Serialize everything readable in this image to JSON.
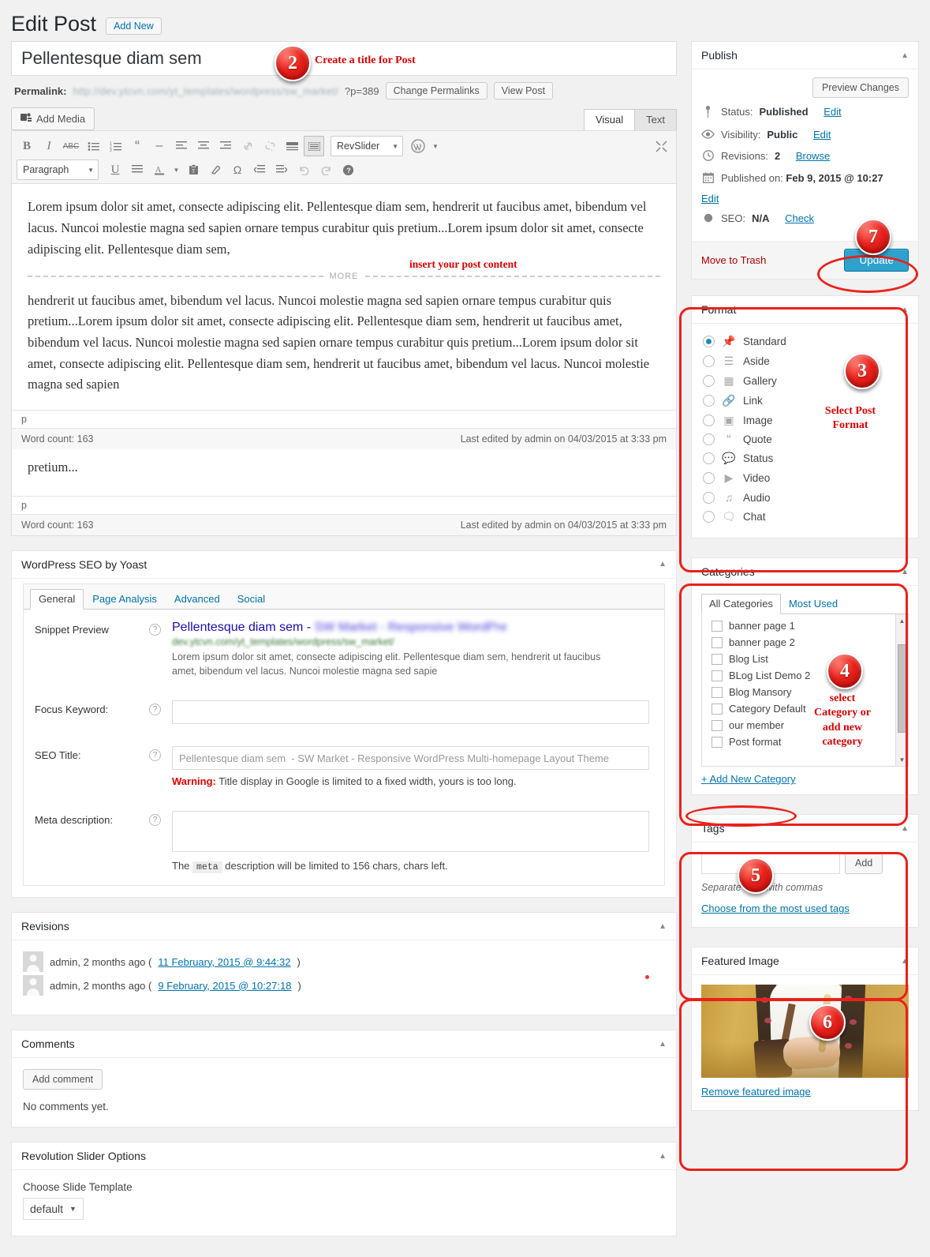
{
  "header": {
    "title": "Edit Post",
    "add_new": "Add New"
  },
  "title_field": {
    "value": "Pellentesque diam sem"
  },
  "permalink": {
    "label": "Permalink:",
    "url": "http://dev.ytcvn.com/yt_templates/wordpress/sw_market/",
    "url_tail": "?p=389",
    "change_button": "Change Permalinks",
    "view_button": "View Post"
  },
  "editor": {
    "add_media": "Add Media",
    "tab_visual": "Visual",
    "tab_text": "Text",
    "toolbar": {
      "revslider": "RevSlider",
      "paragraph": "Paragraph"
    },
    "paragraph1": "Lorem ipsum dolor sit amet, consecte adipiscing elit. Pellentesque diam sem, hendrerit ut faucibus amet, bibendum vel lacus. Nuncoi molestie magna sed sapien ornare tempus curabitur quis pretium...Lorem ipsum dolor sit amet, consecte adipiscing elit. Pellentesque diam sem,",
    "more_label": "MORE",
    "paragraph2": "hendrerit ut faucibus amet, bibendum vel lacus. Nuncoi molestie magna sed sapien ornare tempus curabitur quis pretium...Lorem ipsum dolor sit amet, consecte adipiscing elit. Pellentesque diam sem, hendrerit ut faucibus amet, bibendum vel lacus. Nuncoi molestie magna sed sapien ornare tempus curabitur quis pretium...Lorem ipsum dolor sit amet, consecte adipiscing elit. Pellentesque diam sem, hendrerit ut faucibus amet, bibendum vel lacus. Nuncoi molestie magna sed sapien",
    "paragraph3": "pretium...",
    "path": "p",
    "word_count": "Word count: 163",
    "last_edited": "Last edited by admin on 04/03/2015 at 3:33 pm"
  },
  "yoast": {
    "panel_title": "WordPress SEO by Yoast",
    "tabs": [
      "General",
      "Page Analysis",
      "Advanced",
      "Social"
    ],
    "snippet_label": "Snippet Preview",
    "snippet_title": "Pellentesque diam sem - ",
    "snippet_title_blur": "SW Market - Responsive WordPre",
    "snippet_url": "dev.ytcvn.com/yt_templates/wordpress/sw_market/",
    "snippet_desc": "Lorem ipsum dolor sit amet, consecte adipiscing elit. Pellentesque diam sem, hendrerit ut faucibus amet, bibendum vel lacus. Nuncoi molestie magna sed sapie",
    "focus_keyword_label": "Focus Keyword:",
    "focus_keyword_value": "",
    "seo_title_label": "SEO Title:",
    "seo_title_value": "Pellentesque diam sem  - SW Market - Responsive WordPress Multi-homepage Layout Theme",
    "warning_word": "Warning:",
    "warning_text": " Title display in Google is limited to a fixed width, yours is too long.",
    "meta_label": "Meta description:",
    "meta_value": "",
    "meta_note_pre": "The ",
    "meta_note_code": "meta",
    "meta_note_post": " description will be limited to 156 chars, chars left."
  },
  "revisions": {
    "panel_title": "Revisions",
    "rows": [
      {
        "author": "admin, 2 months ago (",
        "link": "11 February, 2015 @ 9:44:32",
        "close": ")"
      },
      {
        "author": "admin, 2 months ago (",
        "link": "9 February, 2015 @ 10:27:18",
        "close": ")"
      }
    ]
  },
  "comments": {
    "panel_title": "Comments",
    "add_button": "Add comment",
    "empty": "No comments yet."
  },
  "revslider": {
    "panel_title": "Revolution Slider Options",
    "choose_label": "Choose Slide Template",
    "selected": "default"
  },
  "publish": {
    "panel_title": "Publish",
    "preview_button": "Preview Changes",
    "status_label": "Status: ",
    "status_value": "Published",
    "status_edit": "Edit",
    "visibility_label": "Visibility: ",
    "visibility_value": "Public",
    "visibility_edit": "Edit",
    "revisions_label": "Revisions: ",
    "revisions_value": "2",
    "revisions_browse": "Browse",
    "published_label": "Published on: ",
    "published_value": "Feb 9, 2015 @ 10:27",
    "published_edit": "Edit",
    "seo_label": "SEO: ",
    "seo_value": "N/A",
    "seo_check": "Check",
    "trash": "Move to Trash",
    "update_button": "Update"
  },
  "format": {
    "panel_title": "Format",
    "options": [
      {
        "label": "Standard",
        "icon": "pin-icon",
        "glyph": "⚑",
        "selected": true
      },
      {
        "label": "Aside",
        "icon": "aside-icon",
        "glyph": "☰",
        "selected": false
      },
      {
        "label": "Gallery",
        "icon": "gallery-icon",
        "glyph": "▦",
        "selected": false
      },
      {
        "label": "Link",
        "icon": "link-icon",
        "glyph": "🔗",
        "selected": false
      },
      {
        "label": "Image",
        "icon": "image-icon",
        "glyph": "▣",
        "selected": false
      },
      {
        "label": "Quote",
        "icon": "quote-icon",
        "glyph": "“",
        "selected": false
      },
      {
        "label": "Status",
        "icon": "status-icon",
        "glyph": "●",
        "selected": false
      },
      {
        "label": "Video",
        "icon": "video-icon",
        "glyph": "▶",
        "selected": false
      },
      {
        "label": "Audio",
        "icon": "audio-icon",
        "glyph": "♫",
        "selected": false
      },
      {
        "label": "Chat",
        "icon": "chat-icon",
        "glyph": "❐",
        "selected": false
      }
    ]
  },
  "categories": {
    "panel_title": "Categories",
    "tab_all": "All Categories",
    "tab_most_used": "Most Used",
    "items": [
      "banner page 1",
      "banner page 2",
      "Blog List",
      "BLog List Demo 2",
      "Blog Mansory",
      "Category Default",
      "our member",
      "Post format"
    ],
    "add_new": "+ Add New Category"
  },
  "tags": {
    "panel_title": "Tags",
    "input_value": "",
    "add_button": "Add",
    "hint": "Separate tags with commas",
    "choose_link": "Choose from the most used tags"
  },
  "featured_image": {
    "panel_title": "Featured Image",
    "remove_link": "Remove featured image"
  },
  "annotations": {
    "b2": "2",
    "n2": "Create a title for Post",
    "content_note": "insert your post content",
    "b3": "3",
    "n3": "Select Post\nFormat",
    "n3a": "Select Post",
    "n3b": "Format",
    "b4": "4",
    "n4a": "select",
    "n4b": "Category or",
    "n4c": "add new",
    "n4d": "category",
    "b5": "5",
    "b6": "6",
    "b7": "7"
  },
  "colors": {
    "accent_blue": "#2ea2cc",
    "annotation_red": "#e8221c",
    "link_blue": "#0073aa"
  }
}
